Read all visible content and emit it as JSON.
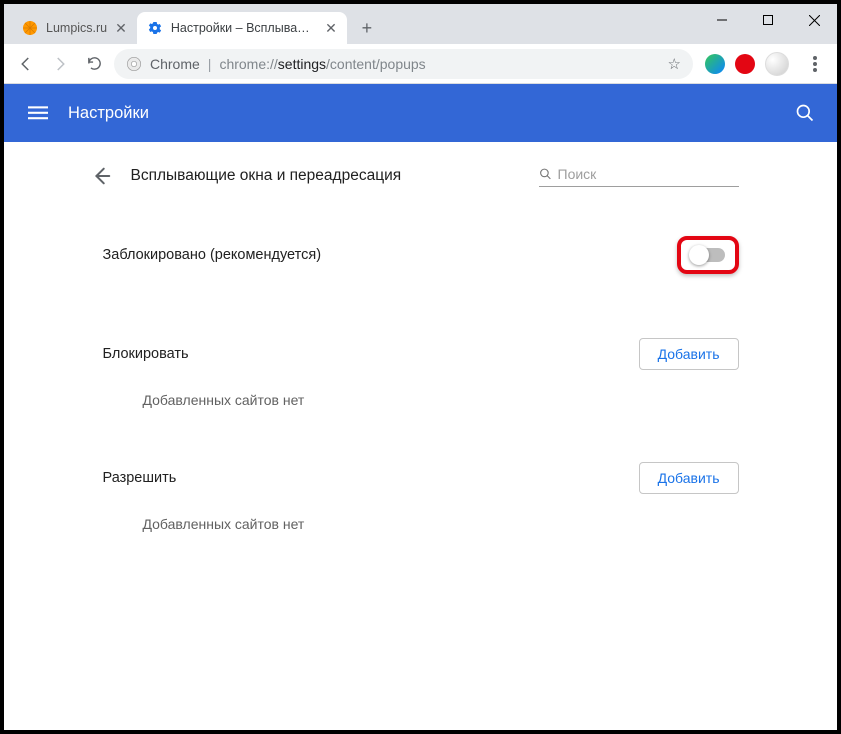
{
  "window": {
    "tabs": [
      {
        "title": "Lumpics.ru",
        "active": false
      },
      {
        "title": "Настройки – Всплывающие окн",
        "active": true
      }
    ]
  },
  "addressbar": {
    "chrome_label": "Chrome",
    "url_prefix": "chrome://",
    "url_bold": "settings",
    "url_suffix": "/content/popups"
  },
  "header": {
    "title": "Настройки"
  },
  "page": {
    "title": "Всплывающие окна и переадресация",
    "search_placeholder": "Поиск",
    "blocked_label": "Заблокировано (рекомендуется)",
    "toggle_on": false,
    "sections": {
      "block": {
        "title": "Блокировать",
        "add_label": "Добавить",
        "empty_text": "Добавленных сайтов нет"
      },
      "allow": {
        "title": "Разрешить",
        "add_label": "Добавить",
        "empty_text": "Добавленных сайтов нет"
      }
    }
  }
}
